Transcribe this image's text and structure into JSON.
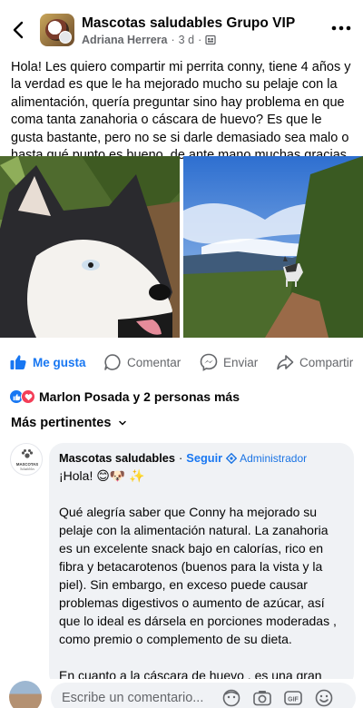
{
  "header": {
    "group_name": "Mascotas saludables Grupo VIP",
    "author": "Adriana Herrera",
    "time": "3 d",
    "separator": "·",
    "icons": {
      "back": "chevron-left-icon",
      "more": "more-options-icon",
      "privacy": "group-privacy-icon"
    }
  },
  "post": {
    "text": "Hola! Les quiero compartir mi perrita conny, tiene 4 años y la verdad es que le ha mejorado mucho su pelaje con la alimentación, quería preguntar sino hay problema en que coma tanta zanahoria o cáscara de huevo? Es que le gusta bastante, pero no se si darle demasiado sea malo o hasta qué punto es bueno, de ante mano muchas gracias"
  },
  "actions": {
    "like": "Me gusta",
    "comment": "Comentar",
    "send": "Enviar",
    "share": "Compartir"
  },
  "reactions": {
    "summary": "Marlon Posada y 2 personas más",
    "icons": [
      "like-reaction-icon",
      "love-reaction-icon"
    ]
  },
  "comments": {
    "sort_label": "Más pertinentes",
    "items": [
      {
        "author": "Mascotas saludables",
        "separator": "·",
        "follow": "Seguir",
        "role": "Administrador",
        "avatar_label": "MASCOTAS",
        "avatar_sublabel": "Saludables",
        "greeting": "¡Hola! 😊🐶 ✨",
        "paragraph1": "Qué alegría saber que Conny ha mejorado su pelaje con la alimentación natural. La zanahoria es un excelente snack bajo en calorías, rico en fibra y betacarotenos (buenos para la vista y la piel). Sin embargo, en exceso puede causar problemas digestivos o aumento de azúcar, así que lo ideal es dársela en porciones moderadas , como premio o complemento de su dieta.",
        "paragraph2": "En cuanto a la cáscara de huevo , es una gran fuente natural de calcio , perfecta para fortalecer"
      }
    ]
  },
  "composer": {
    "placeholder": "Escribe un comentario...",
    "icons": [
      "avatar-sticker-icon",
      "camera-icon",
      "gif-icon",
      "emoji-icon"
    ],
    "gif_label": "GIF"
  },
  "colors": {
    "accent": "#1877f2",
    "muted": "#65676b",
    "bubble": "#f0f2f5",
    "love": "#f33e58"
  }
}
